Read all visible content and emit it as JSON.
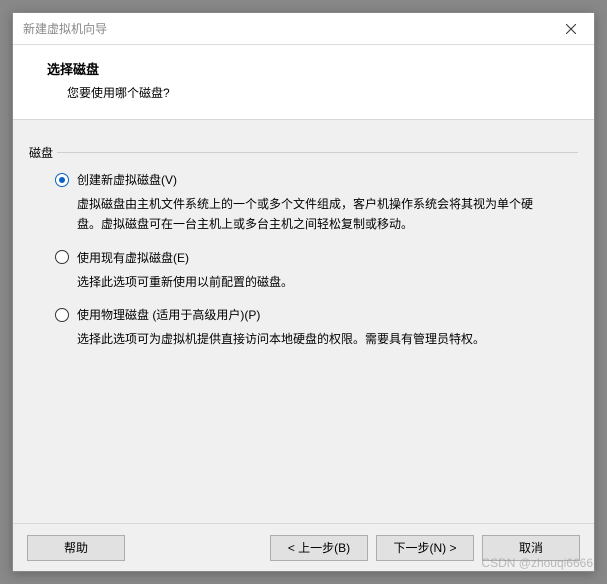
{
  "window": {
    "title": "新建虚拟机向导"
  },
  "header": {
    "title": "选择磁盘",
    "subtitle": "您要使用哪个磁盘?"
  },
  "group": {
    "label": "磁盘"
  },
  "options": [
    {
      "label": "创建新虚拟磁盘(V)",
      "desc": "虚拟磁盘由主机文件系统上的一个或多个文件组成，客户机操作系统会将其视为单个硬盘。虚拟磁盘可在一台主机上或多台主机之间轻松复制或移动。",
      "selected": true
    },
    {
      "label": "使用现有虚拟磁盘(E)",
      "desc": "选择此选项可重新使用以前配置的磁盘。",
      "selected": false
    },
    {
      "label": "使用物理磁盘 (适用于高级用户)(P)",
      "desc": "选择此选项可为虚拟机提供直接访问本地硬盘的权限。需要具有管理员特权。",
      "selected": false
    }
  ],
  "buttons": {
    "help": "帮助",
    "back": "< 上一步(B)",
    "next": "下一步(N) >",
    "cancel": "取消"
  },
  "watermark": "CSDN @zhouqi6666"
}
